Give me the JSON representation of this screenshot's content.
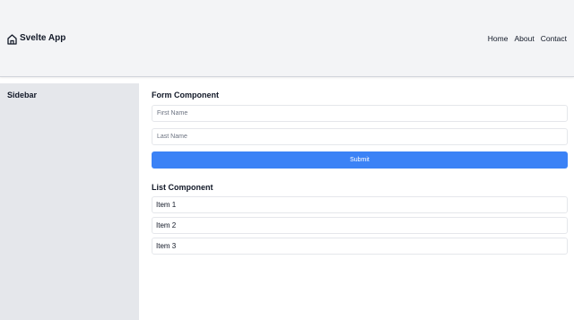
{
  "header": {
    "app_title": "Svelte App",
    "brand_icon": "home-icon",
    "nav": [
      "Home",
      "About",
      "Contact"
    ]
  },
  "sidebar": {
    "title": "Sidebar"
  },
  "form": {
    "title": "Form Component",
    "first_name_placeholder": "First Name",
    "last_name_placeholder": "Last Name",
    "submit_label": "Submit",
    "submit_color": "#3b82f6"
  },
  "list": {
    "title": "List Component",
    "items": [
      "Item 1",
      "Item 2",
      "Item 3"
    ]
  }
}
